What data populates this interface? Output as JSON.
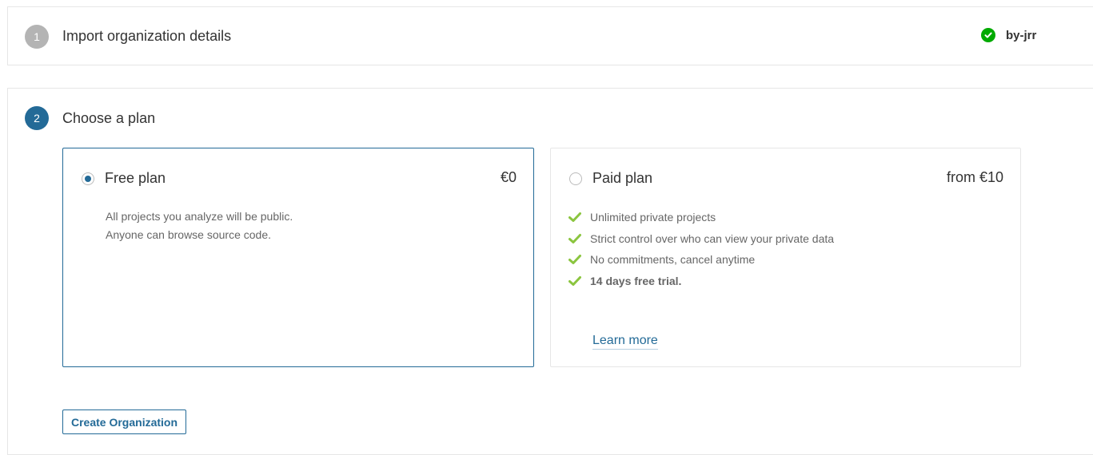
{
  "step1": {
    "number": "1",
    "title": "Import organization details",
    "org_name": "by-jrr",
    "status_icon": "check-circle-icon"
  },
  "step2": {
    "number": "2",
    "title": "Choose a plan",
    "free_plan": {
      "name": "Free plan",
      "price": "€0",
      "selected": true,
      "description": [
        "All projects you analyze will be public.",
        "Anyone can browse source code."
      ]
    },
    "paid_plan": {
      "name": "Paid plan",
      "price": "from €10",
      "selected": false,
      "features": [
        "Unlimited private projects",
        "Strict control over who can view your private data",
        "No commitments, cancel anytime",
        "14 days free trial."
      ],
      "learn_more": "Learn more"
    },
    "create_button": "Create Organization"
  },
  "colors": {
    "accent": "#236a97",
    "success": "#00aa00",
    "feature_check": "#8bc53f"
  }
}
